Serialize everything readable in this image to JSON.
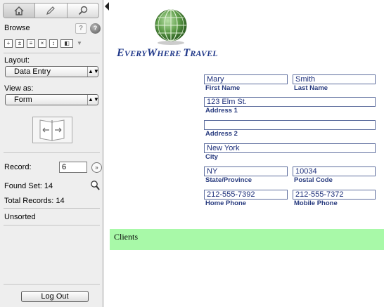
{
  "sidebar": {
    "mode": "Browse",
    "mode_tabs": [
      {
        "name": "home-icon",
        "glyph": "⌂"
      },
      {
        "name": "pencil-icon",
        "glyph": "✎"
      },
      {
        "name": "magnifier-icon",
        "glyph": "⚲"
      }
    ],
    "layout_label": "Layout:",
    "layout_value": "Data Entry",
    "view_label": "View as:",
    "view_value": "Form",
    "record_label": "Record:",
    "record_value": "6",
    "found_set": "Found Set: 14",
    "total_records": "Total Records: 14",
    "sort_status": "Unsorted",
    "logout_label": "Log Out"
  },
  "brand": {
    "e": "E",
    "very": "VERY",
    "w": "W",
    "here": "HERE",
    "t": "T",
    "ravel": "RAVEL"
  },
  "form": {
    "first_name": {
      "value": "Mary",
      "label": "First Name"
    },
    "last_name": {
      "value": "Smith",
      "label": "Last Name"
    },
    "address1": {
      "value": "123 Elm St.",
      "label": "Address 1"
    },
    "address2": {
      "value": "",
      "label": "Address 2"
    },
    "city": {
      "value": "New York",
      "label": "City"
    },
    "state": {
      "value": "NY",
      "label": "State/Province"
    },
    "postal": {
      "value": "10034",
      "label": "Postal Code"
    },
    "home_phone": {
      "value": "212-555-7392",
      "label": "Home Phone"
    },
    "mobile_phone": {
      "value": "212-555-7372",
      "label": "Mobile Phone"
    }
  },
  "portal": {
    "label": "Clients"
  },
  "colors": {
    "brand_blue": "#21398a",
    "portal_green": "#a8f9a8",
    "globe_green": "#4a8c3a"
  }
}
